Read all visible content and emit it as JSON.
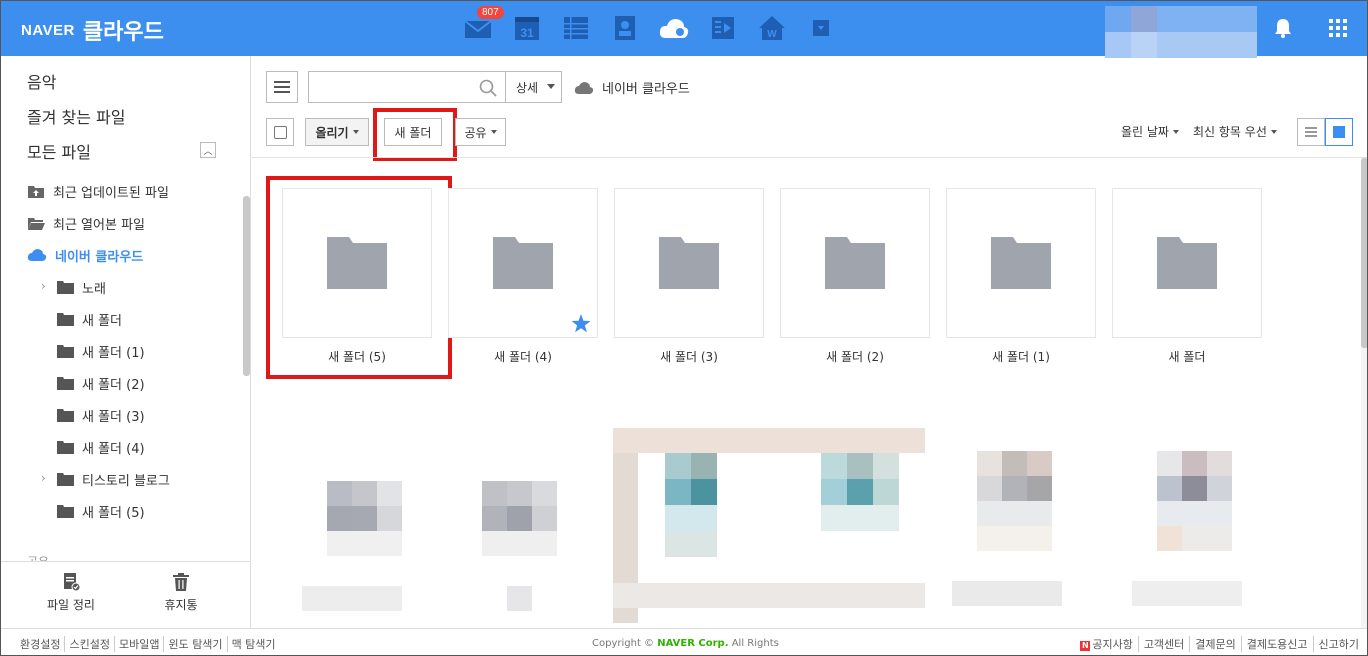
{
  "header": {
    "logo_brand": "NAVER",
    "logo_service": "클라우드",
    "mail_badge": "807",
    "calendar_day": "31"
  },
  "sidebar": {
    "top_items": [
      "음악",
      "즐겨 찾는 파일",
      "모든 파일"
    ],
    "tree": [
      {
        "label": "최근 업데이트된 파일",
        "icon": "recent-update-icon"
      },
      {
        "label": "최근 열어본 파일",
        "icon": "open-folder-icon"
      },
      {
        "label": "네이버 클라우드",
        "icon": "cloud-icon",
        "active": true
      },
      {
        "label": "노래",
        "icon": "folder-icon",
        "expandable": true
      },
      {
        "label": "새 폴더",
        "icon": "folder-icon"
      },
      {
        "label": "새 폴더 (1)",
        "icon": "folder-icon"
      },
      {
        "label": "새 폴더 (2)",
        "icon": "folder-icon"
      },
      {
        "label": "새 폴더 (3)",
        "icon": "folder-icon"
      },
      {
        "label": "새 폴더 (4)",
        "icon": "folder-icon"
      },
      {
        "label": "티스토리 블로그",
        "icon": "folder-icon",
        "expandable": true
      },
      {
        "label": "새 폴더 (5)",
        "icon": "folder-icon"
      }
    ],
    "share_label": "공유",
    "bottom": {
      "organize": "파일 정리",
      "trash": "휴지통"
    }
  },
  "toolbar": {
    "search_placeholder": "",
    "detail": "상세",
    "breadcrumb": "네이버 클라우드",
    "upload": "올리기",
    "new_folder": "새 폴더",
    "share": "공유",
    "sort_by": "올린 날짜",
    "sort_order": "최신 항목 우선"
  },
  "folders": [
    {
      "name": "새 폴더 (5)",
      "starred": false,
      "highlighted": true
    },
    {
      "name": "새 폴더 (4)",
      "starred": true,
      "highlighted": false
    },
    {
      "name": "새 폴더 (3)",
      "starred": false,
      "highlighted": false
    },
    {
      "name": "새 폴더 (2)",
      "starred": false,
      "highlighted": false
    },
    {
      "name": "새 폴더 (1)",
      "starred": false,
      "highlighted": false
    },
    {
      "name": "새 폴더",
      "starred": false,
      "highlighted": false
    }
  ],
  "footer": {
    "left_links": [
      "환경설정",
      "스킨설정",
      "모바일앱",
      "윈도 탐색기",
      "맥 탐색기"
    ],
    "copyright_prefix": "Copyright ©",
    "copyright_brand": "NAVER Corp.",
    "copyright_suffix": "All Rights",
    "right_links": [
      "공지사항",
      "고객센터",
      "결제문의",
      "결제도용신고",
      "신고하기"
    ],
    "notice_badge": "N"
  },
  "colors": {
    "header_blue": "#3d8fef",
    "highlight_red": "#e01818",
    "folder_gray": "#a0a5ad",
    "star_blue": "#3d8fef"
  }
}
